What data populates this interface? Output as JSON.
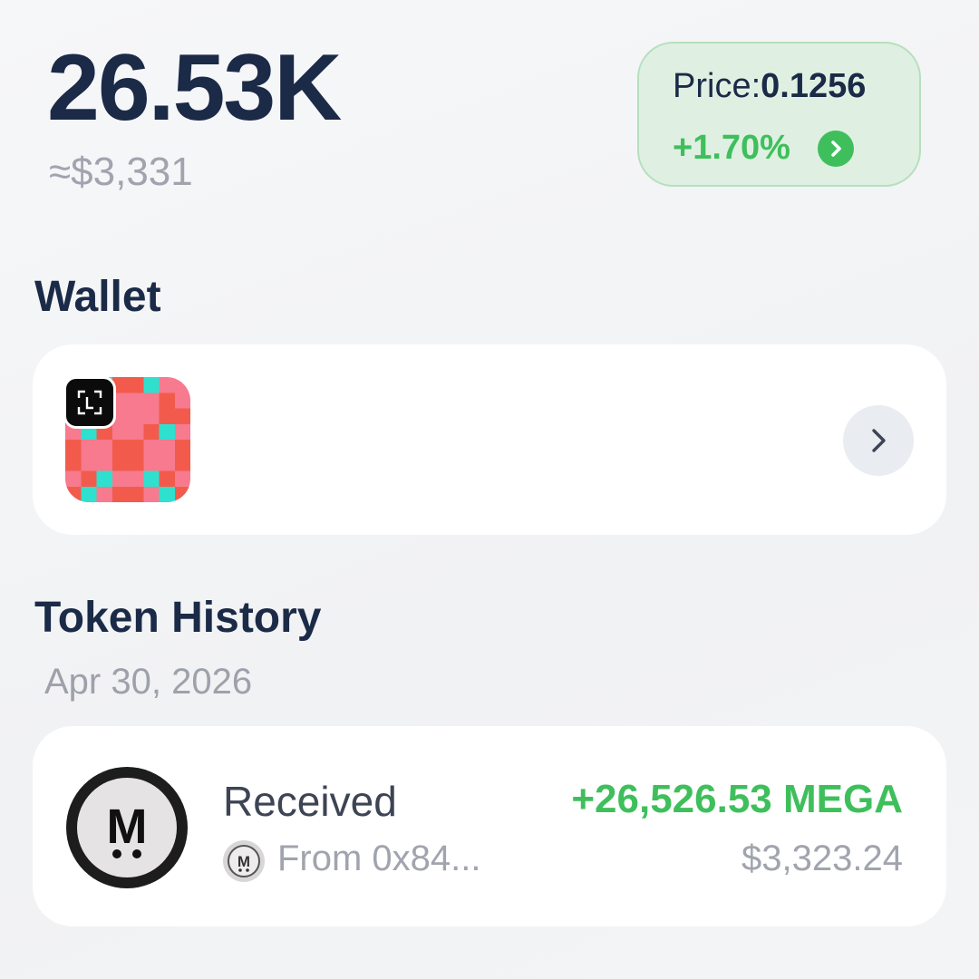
{
  "balance": {
    "amount": "26.53K",
    "usd_value": "≈$3,331"
  },
  "price": {
    "label": "Price:",
    "value": "0.1256",
    "change": "+1.70%",
    "icon": "chevron-right-circle-icon",
    "change_color": "#3fbf5c"
  },
  "wallet": {
    "title": "Wallet",
    "avatar_icon": "identicon-avatar",
    "scan_icon": "scan-icon",
    "chevron_icon": "chevron-right-icon",
    "avatar_colors": [
      "#f25b4c",
      "#f77a8e",
      "#2fe0cf"
    ]
  },
  "history": {
    "title": "Token History",
    "groups": [
      {
        "date": "Apr 30, 2026",
        "transactions": [
          {
            "type": "Received",
            "from": "From 0x84...",
            "amount": "+26,526.53 MEGA",
            "usd": "$3,323.24",
            "token_icon": "mega-token-icon"
          }
        ]
      }
    ]
  },
  "colors": {
    "text_dark": "#1b2a47",
    "text_muted": "#a1a4ae",
    "positive": "#3fbf5c",
    "card_bg": "#ffffff",
    "page_bg": "#f3f4f6"
  }
}
